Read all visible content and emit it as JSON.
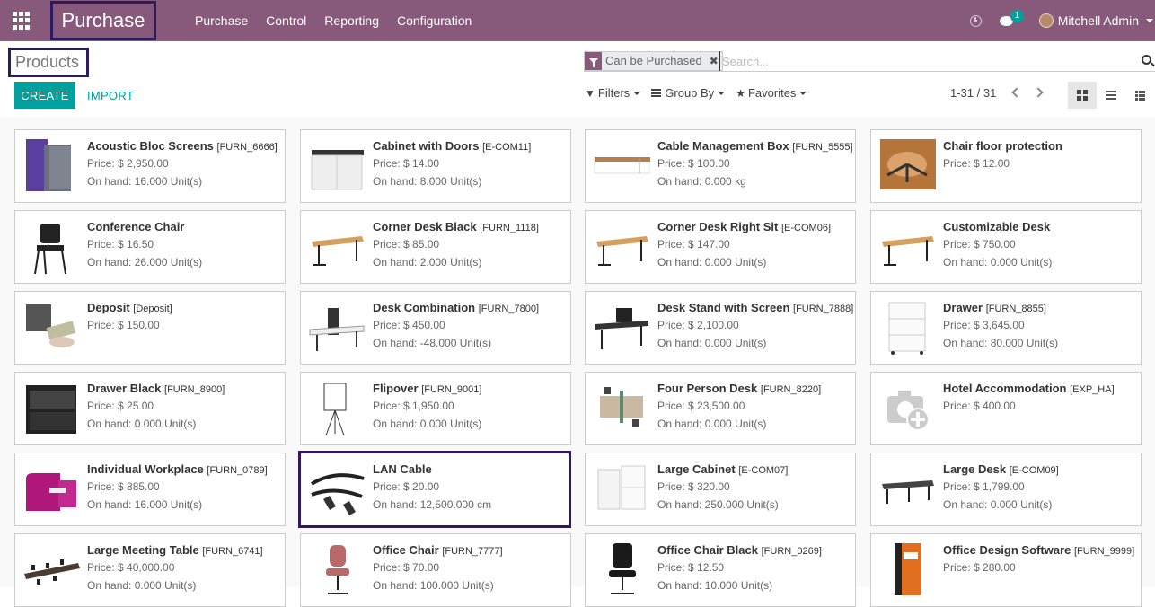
{
  "navbar": {
    "app_name": "Purchase",
    "menu": [
      "Purchase",
      "Control",
      "Reporting",
      "Configuration"
    ],
    "chat_badge": "1",
    "user_name": "Mitchell Admin"
  },
  "breadcrumb": "Products",
  "search": {
    "facet": "Can be Purchased",
    "placeholder": "Search..."
  },
  "buttons": {
    "create": "CREATE",
    "import": "IMPORT"
  },
  "search_options": {
    "filters": "Filters",
    "group_by": "Group By",
    "favorites": "Favorites"
  },
  "pager": "1-31 / 31",
  "colors": {
    "brand": "#875a7b",
    "accent": "#00a09d",
    "highlight": "#2e1a5e"
  },
  "products": [
    {
      "name": "Acoustic Bloc Screens",
      "ref": "[FURN_6666]",
      "price": "Price: $ 2,950.00",
      "onhand": "On hand: 16.000 Unit(s)",
      "icon": "acoustic-screen-image"
    },
    {
      "name": "Cabinet with Doors",
      "ref": "[E-COM11]",
      "price": "Price: $ 14.00",
      "onhand": "On hand: 8.000 Unit(s)",
      "icon": "cabinet-image"
    },
    {
      "name": "Cable Management Box",
      "ref": "[FURN_5555]",
      "price": "Price: $ 100.00",
      "onhand": "On hand: 0.000 kg",
      "icon": "cable-box-image"
    },
    {
      "name": "Chair floor protection",
      "ref": "",
      "price": "Price: $ 12.00",
      "onhand": "",
      "icon": "floor-protection-image"
    },
    {
      "name": "Conference Chair",
      "ref": "",
      "price": "Price: $ 16.50",
      "onhand": "On hand: 26.000 Unit(s)",
      "icon": "chair-image"
    },
    {
      "name": "Corner Desk Black",
      "ref": "[FURN_1118]",
      "price": "Price: $ 85.00",
      "onhand": "On hand: 2.000 Unit(s)",
      "icon": "desk-image"
    },
    {
      "name": "Corner Desk Right Sit",
      "ref": "[E-COM06]",
      "price": "Price: $ 147.00",
      "onhand": "On hand: 0.000 Unit(s)",
      "icon": "desk-image"
    },
    {
      "name": "Customizable Desk",
      "ref": "",
      "price": "Price: $ 750.00",
      "onhand": "On hand: 0.000 Unit(s)",
      "icon": "desk-image"
    },
    {
      "name": "Deposit",
      "ref": "[Deposit]",
      "price": "Price: $ 150.00",
      "onhand": "",
      "icon": "money-image"
    },
    {
      "name": "Desk Combination",
      "ref": "[FURN_7800]",
      "price": "Price: $ 450.00",
      "onhand": "On hand: -48.000 Unit(s)",
      "icon": "desk-combo-image"
    },
    {
      "name": "Desk Stand with Screen",
      "ref": "[FURN_7888]",
      "price": "Price: $ 2,100.00",
      "onhand": "On hand: 0.000 Unit(s)",
      "icon": "desk-screen-image"
    },
    {
      "name": "Drawer",
      "ref": "[FURN_8855]",
      "price": "Price: $ 3,645.00",
      "onhand": "On hand: 80.000 Unit(s)",
      "icon": "drawer-image"
    },
    {
      "name": "Drawer Black",
      "ref": "[FURN_8900]",
      "price": "Price: $ 25.00",
      "onhand": "On hand: 0.000 Unit(s)",
      "icon": "drawer-black-image"
    },
    {
      "name": "Flipover",
      "ref": "[FURN_9001]",
      "price": "Price: $ 1,950.00",
      "onhand": "On hand: 0.000 Unit(s)",
      "icon": "flipover-image"
    },
    {
      "name": "Four Person Desk",
      "ref": "[FURN_8220]",
      "price": "Price: $ 23,500.00",
      "onhand": "On hand: 0.000 Unit(s)",
      "icon": "four-desk-image"
    },
    {
      "name": "Hotel Accommodation",
      "ref": "[EXP_HA]",
      "price": "Price: $ 400.00",
      "onhand": "",
      "icon": "camera-placeholder-icon"
    },
    {
      "name": "Individual Workplace",
      "ref": "[FURN_0789]",
      "price": "Price: $ 885.00",
      "onhand": "On hand: 16.000 Unit(s)",
      "icon": "workplace-image"
    },
    {
      "name": "LAN Cable",
      "ref": "",
      "price": "Price: $ 20.00",
      "onhand": "On hand: 12,500.000 cm",
      "icon": "lan-cable-image"
    },
    {
      "name": "Large Cabinet",
      "ref": "[E-COM07]",
      "price": "Price: $ 320.00",
      "onhand": "On hand: 250.000 Unit(s)",
      "icon": "large-cabinet-image"
    },
    {
      "name": "Large Desk",
      "ref": "[E-COM09]",
      "price": "Price: $ 1,799.00",
      "onhand": "On hand: 0.000 Unit(s)",
      "icon": "large-desk-image"
    },
    {
      "name": "Large Meeting Table",
      "ref": "[FURN_6741]",
      "price": "Price: $ 40,000.00",
      "onhand": "On hand: 0.000 Unit(s)",
      "icon": "meeting-table-image"
    },
    {
      "name": "Office Chair",
      "ref": "[FURN_7777]",
      "price": "Price: $ 70.00",
      "onhand": "On hand: 100.000 Unit(s)",
      "icon": "office-chair-image"
    },
    {
      "name": "Office Chair Black",
      "ref": "[FURN_0269]",
      "price": "Price: $ 12.50",
      "onhand": "On hand: 10.000 Unit(s)",
      "icon": "office-chair-black-image"
    },
    {
      "name": "Office Design Software",
      "ref": "[FURN_9999]",
      "price": "Price: $ 280.00",
      "onhand": "",
      "icon": "software-box-image"
    }
  ]
}
